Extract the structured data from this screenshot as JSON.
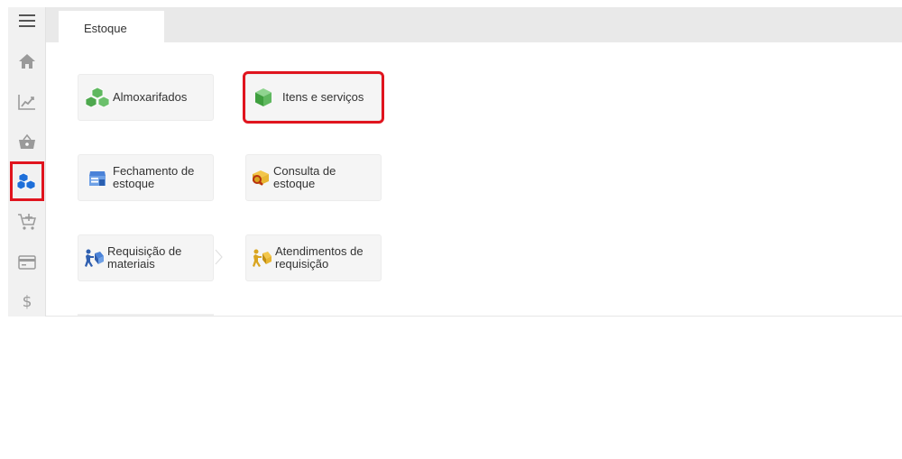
{
  "sidebar": {
    "items": [
      {
        "icon": "hamburger-menu-icon"
      },
      {
        "icon": "home-icon"
      },
      {
        "icon": "chart-trend-icon"
      },
      {
        "icon": "basket-icon"
      },
      {
        "icon": "boxes-icon",
        "active": true
      },
      {
        "icon": "cart-add-icon"
      },
      {
        "icon": "card-icon"
      },
      {
        "icon": "dollar-icon"
      }
    ]
  },
  "tabs": [
    {
      "label": "Estoque"
    }
  ],
  "tiles": [
    {
      "label": "Almoxarifados",
      "icon": "boxes-green-icon"
    },
    {
      "label": "Itens e serviços",
      "icon": "cube-green-icon",
      "highlighted": true
    },
    {
      "label_line1": "Fechamento de",
      "label_line2": "estoque",
      "icon": "close-stock-icon"
    },
    {
      "label": "Consulta de estoque",
      "icon": "search-box-icon"
    },
    {
      "label_line1": "Requisição de",
      "label_line2": "materiais",
      "icon": "carry-box-icon"
    },
    {
      "label_line1": "Atendimentos de",
      "label_line2": "requisição",
      "icon": "carry-box-yellow-icon"
    }
  ],
  "colors": {
    "highlight": "#e0141e",
    "sidebar_icon": "#9a9a9a",
    "active_icon": "#1e6fd9"
  }
}
